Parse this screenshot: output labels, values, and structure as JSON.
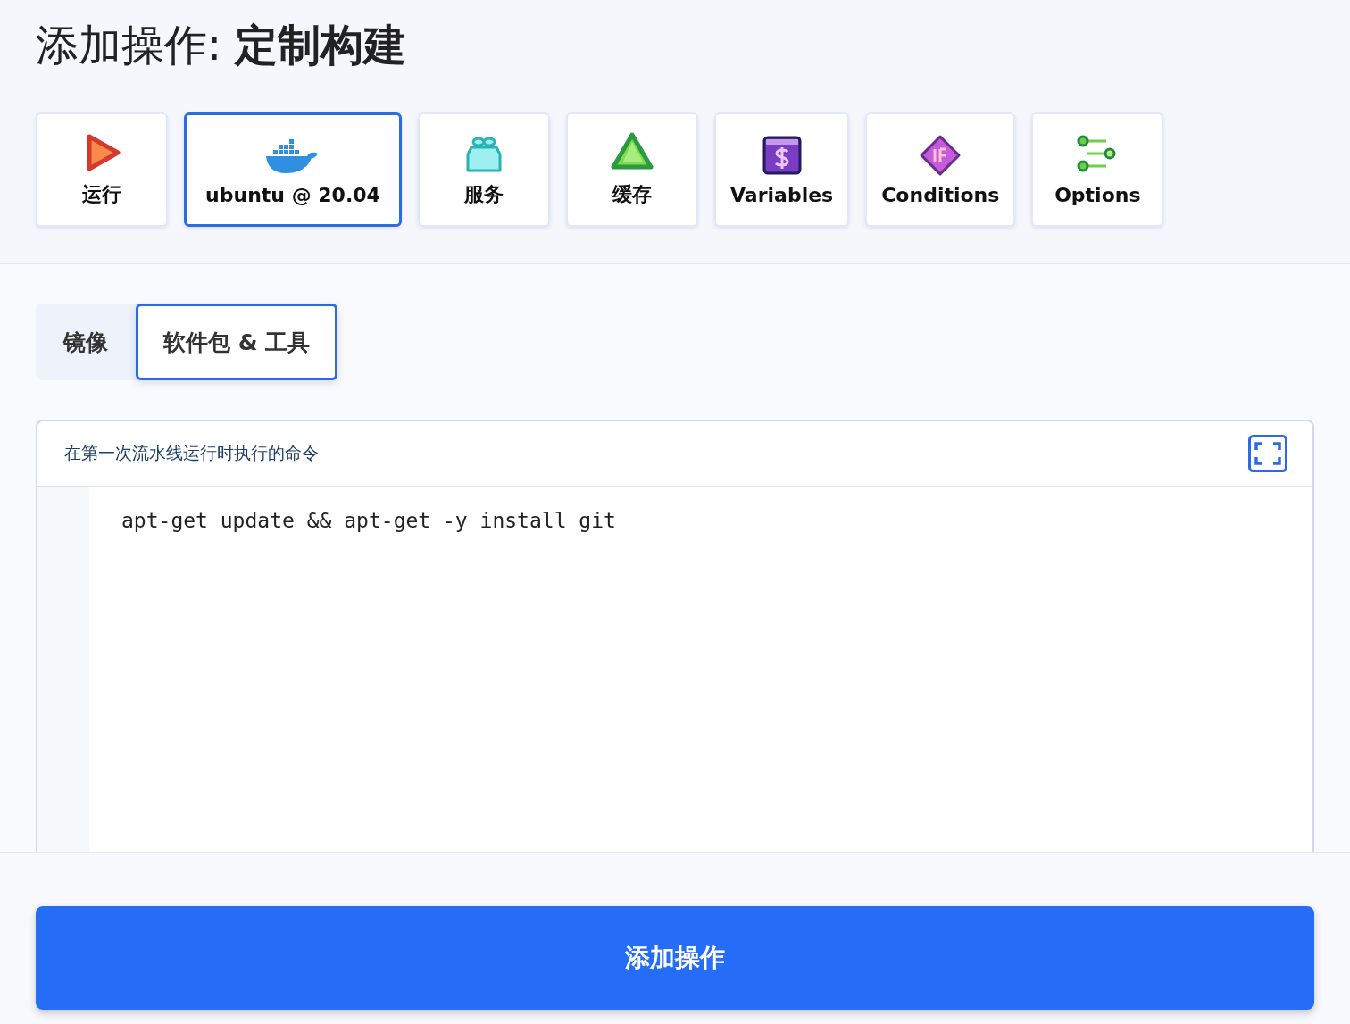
{
  "title": "添加操作: **定制构建**",
  "action_types": [
    {
      "kind": "run",
      "label": "运行",
      "selected": false
    },
    {
      "kind": "docker",
      "label": "ubuntu @ 20.04",
      "selected": true
    },
    {
      "kind": "service",
      "label": "服务",
      "selected": false
    },
    {
      "kind": "cache",
      "label": "缓存",
      "selected": false
    },
    {
      "kind": "variables",
      "label": "Variables",
      "selected": false
    },
    {
      "kind": "conditions",
      "label": "Conditions",
      "selected": false
    },
    {
      "kind": "options",
      "label": "Options",
      "selected": false
    }
  ],
  "tabs": [
    {
      "label": "镜像",
      "selected": false
    },
    {
      "label": "软件包 & 工具",
      "selected": true
    }
  ],
  "editor": {
    "label": "在第一次流水线运行时执行的命令",
    "code": "apt-get update && apt-get -y install git"
  },
  "submit_button": "添加操作"
}
